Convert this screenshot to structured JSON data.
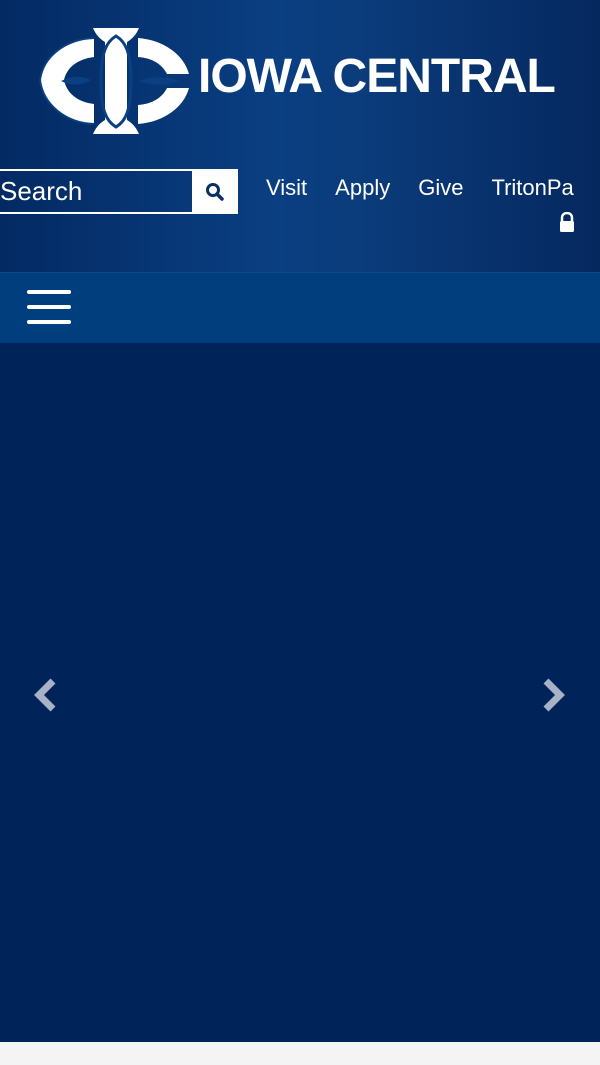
{
  "brand": {
    "name": "IOWA CENTRAL",
    "colors": {
      "header_dark": "#032a63",
      "nav_blue": "#003e7e",
      "hero_blue": "#002459",
      "text": "#ffffff",
      "footer": "#f4f4f5"
    }
  },
  "search": {
    "placeholder": "Search",
    "icon": "search-icon"
  },
  "top_links": [
    {
      "label": "Visit"
    },
    {
      "label": "Apply"
    },
    {
      "label": "Give"
    },
    {
      "label": "TritonPa"
    }
  ],
  "icons": {
    "lock": "lock-icon",
    "menu": "hamburger-menu-icon",
    "previous": "chevron-left-icon",
    "next": "chevron-right-icon"
  }
}
